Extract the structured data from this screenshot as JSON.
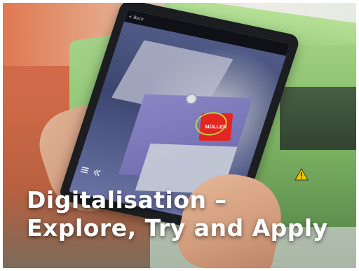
{
  "headline": {
    "line1": "Digitalisation –",
    "line2": "Explore, Try and Apply"
  },
  "tablet": {
    "back_label": "< Back",
    "screen_title": "",
    "screen_label": "",
    "logo_text": "MÜLLER"
  },
  "icons": {
    "list": "list-icon",
    "chevrons": "double-chevron-left-icon",
    "warning": "warning-triangle-icon"
  },
  "colors": {
    "machine_green": "#94c97a",
    "logo_red": "#e42520",
    "ar_highlight": "#b8e04a",
    "headline": "#ffffff"
  }
}
